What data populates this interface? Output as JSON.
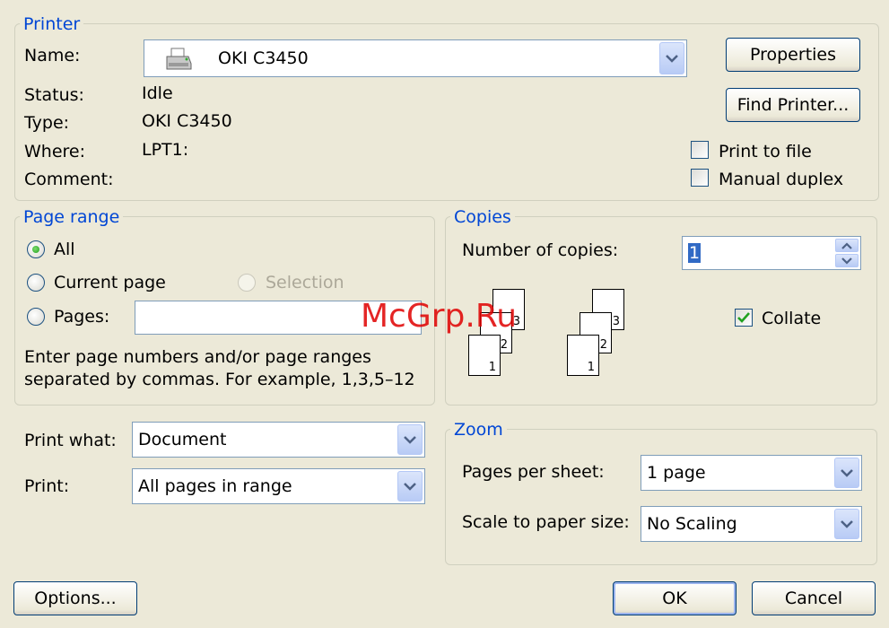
{
  "printer": {
    "legend": "Printer",
    "name_label": "Name:",
    "name_value": "OKI C3450",
    "status_label": "Status:",
    "status_value": "Idle",
    "type_label": "Type:",
    "type_value": "OKI C3450",
    "where_label": "Where:",
    "where_value": "LPT1:",
    "comment_label": "Comment:",
    "properties_button": "Properties",
    "find_printer_button": "Find Printer...",
    "print_to_file_label": "Print to file",
    "print_to_file_checked": false,
    "manual_duplex_label": "Manual duplex",
    "manual_duplex_checked": false
  },
  "page_range": {
    "legend": "Page range",
    "all_label": "All",
    "current_page_label": "Current page",
    "selection_label": "Selection",
    "pages_label": "Pages:",
    "pages_value": "",
    "selected": "all",
    "help_line1": "Enter page numbers and/or page ranges",
    "help_line2": "separated by commas.  For example, 1,3,5–12"
  },
  "copies": {
    "legend": "Copies",
    "number_label": "Number of copies:",
    "number_value": "1",
    "collate_label": "Collate",
    "collate_checked": true,
    "page_numbers_left": [
      "3",
      "2",
      "1"
    ],
    "page_numbers_right": [
      "3",
      "2",
      "1"
    ]
  },
  "print_what": {
    "label": "Print what:",
    "value": "Document"
  },
  "print": {
    "label": "Print:",
    "value": "All pages in range"
  },
  "zoom": {
    "legend": "Zoom",
    "pages_per_sheet_label": "Pages per sheet:",
    "pages_per_sheet_value": "1 page",
    "scale_label": "Scale to paper size:",
    "scale_value": "No Scaling"
  },
  "buttons": {
    "options": "Options...",
    "ok": "OK",
    "cancel": "Cancel"
  },
  "watermark": "McGrp.Ru",
  "colors": {
    "background": "#ece9d8",
    "legend_blue": "#0046d5",
    "watermark_red": "#e00000"
  }
}
